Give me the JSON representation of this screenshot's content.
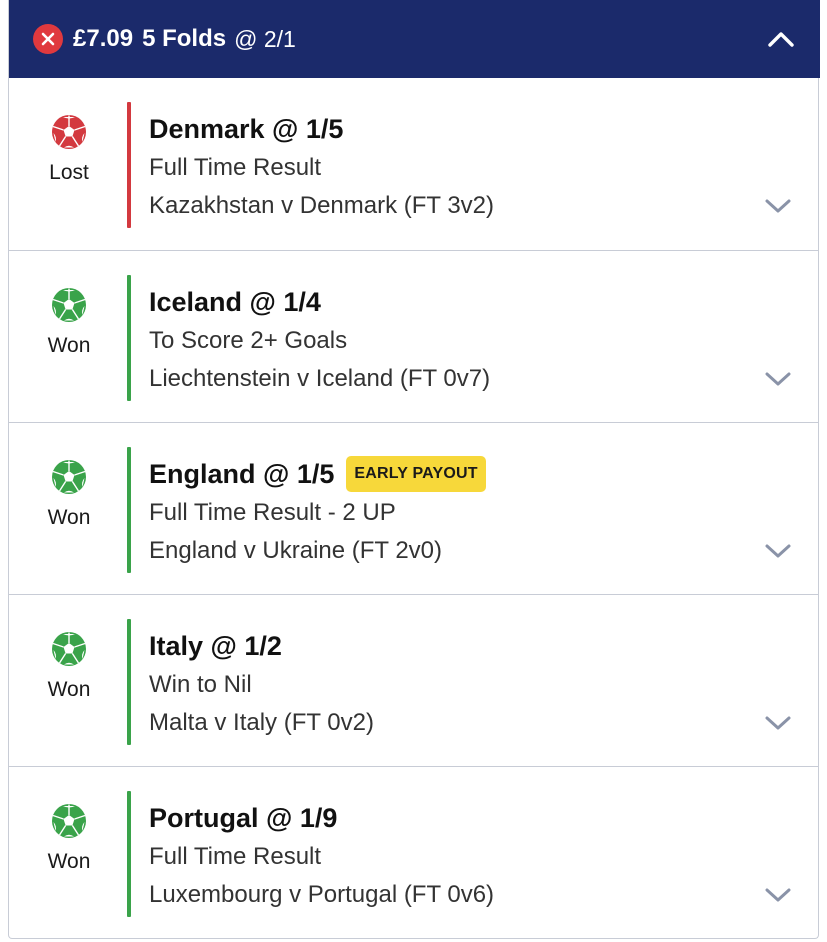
{
  "header": {
    "stake": "£7.09",
    "bet_type": "5 Folds",
    "odds": "@ 2/1",
    "status_icon": "close-icon",
    "collapse_icon": "chevron-up-icon",
    "color_bg": "#1b2a6b"
  },
  "colors": {
    "won": "#3aa34a",
    "lost": "#d3393f",
    "badge": "#f7d83a"
  },
  "legs": [
    {
      "status": "Lost",
      "selection": "Denmark @ 1/5",
      "badge": "",
      "market": "Full Time Result",
      "event": "Kazakhstan v Denmark (FT 3v2)"
    },
    {
      "status": "Won",
      "selection": "Iceland @ 1/4",
      "badge": "",
      "market": "To Score 2+ Goals",
      "event": "Liechtenstein v Iceland (FT 0v7)"
    },
    {
      "status": "Won",
      "selection": "England @ 1/5",
      "badge": "EARLY PAYOUT",
      "market": "Full Time Result - 2 UP",
      "event": "England v Ukraine (FT 2v0)"
    },
    {
      "status": "Won",
      "selection": "Italy @ 1/2",
      "badge": "",
      "market": "Win to Nil",
      "event": "Malta v Italy (FT 0v2)"
    },
    {
      "status": "Won",
      "selection": "Portugal @ 1/9",
      "badge": "",
      "market": "Full Time Result",
      "event": "Luxembourg v Portugal (FT 0v6)"
    }
  ]
}
